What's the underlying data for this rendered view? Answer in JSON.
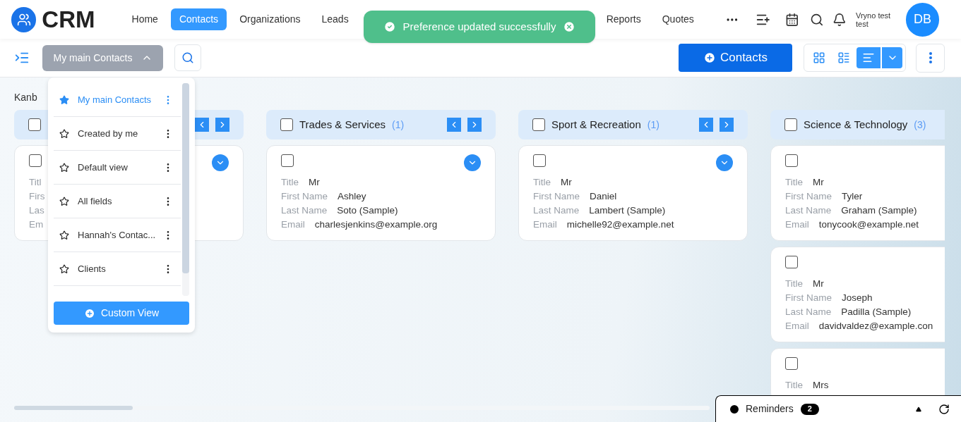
{
  "brand": {
    "name": "CRM"
  },
  "nav": [
    {
      "label": "Home",
      "selected": false
    },
    {
      "label": "Contacts",
      "selected": true
    },
    {
      "label": "Organizations",
      "selected": false
    },
    {
      "label": "Leads",
      "selected": false
    },
    {
      "label": "Reports",
      "selected": false
    },
    {
      "label": "Quotes",
      "selected": false
    }
  ],
  "user": {
    "name": "Vryno test test",
    "initials": "DB"
  },
  "toast": {
    "message": "Preference updated successfully"
  },
  "toolbar": {
    "view_button": {
      "label": "My main Contacts",
      "expanded": true
    },
    "add_button": "Contacts",
    "view_modes": [
      {
        "kind": "grid",
        "selected": false
      },
      {
        "kind": "list",
        "selected": false
      },
      {
        "kind": "kanban",
        "selected": true
      }
    ]
  },
  "view_menu": {
    "items": [
      {
        "label": "My main Contacts",
        "selected": true
      },
      {
        "label": "Created by me",
        "selected": false
      },
      {
        "label": "Default view",
        "selected": false
      },
      {
        "label": "All fields",
        "selected": false
      },
      {
        "label": "Hannah's Contac...",
        "selected": false
      },
      {
        "label": "Clients",
        "selected": false
      }
    ],
    "button": "Custom View"
  },
  "section_label": "Kanb",
  "columns": [
    {
      "checked": false,
      "paging": true,
      "cards": [
        {
          "checked": false,
          "expand_button": true,
          "fields": [
            {
              "label": "Titl"
            },
            {
              "label": "Firs"
            },
            {
              "label": "Las"
            },
            {
              "label": "Em"
            }
          ]
        }
      ]
    },
    {
      "title": "Trades & Services",
      "count": "(1)",
      "checked": false,
      "paging": true,
      "cards": [
        {
          "checked": false,
          "expand_button": true,
          "fields": [
            {
              "label": "Title",
              "value": "Mr"
            },
            {
              "label": "First Name",
              "value": "Ashley"
            },
            {
              "label": "Last Name",
              "value": "Soto (Sample)"
            },
            {
              "label": "Email",
              "value": "charlesjenkins@example.org"
            }
          ]
        }
      ]
    },
    {
      "title": "Sport & Recreation",
      "count": "(1)",
      "checked": false,
      "paging": true,
      "cards": [
        {
          "checked": false,
          "expand_button": true,
          "fields": [
            {
              "label": "Title",
              "value": "Mr"
            },
            {
              "label": "First Name",
              "value": "Daniel"
            },
            {
              "label": "Last Name",
              "value": "Lambert (Sample)"
            },
            {
              "label": "Email",
              "value": "michelle92@example.net"
            }
          ]
        }
      ]
    },
    {
      "title": "Science & Technology",
      "count": "(3)",
      "checked": false,
      "paging": false,
      "cards": [
        {
          "checked": false,
          "expand_button": false,
          "fields": [
            {
              "label": "Title",
              "value": "Mr"
            },
            {
              "label": "First Name",
              "value": "Tyler"
            },
            {
              "label": "Last Name",
              "value": "Graham (Sample)"
            },
            {
              "label": "Email",
              "value": "tonycook@example.net"
            }
          ]
        },
        {
          "checked": false,
          "expand_button": false,
          "fields": [
            {
              "label": "Title",
              "value": "Mr"
            },
            {
              "label": "First Name",
              "value": "Joseph"
            },
            {
              "label": "Last Name",
              "value": "Padilla (Sample)"
            },
            {
              "label": "Email",
              "value": "davidvaldez@example.con"
            }
          ]
        },
        {
          "checked": false,
          "expand_button": false,
          "fields": [
            {
              "label": "Title",
              "value": "Mrs"
            }
          ]
        }
      ]
    }
  ],
  "reminders": {
    "label": "Reminders",
    "count": "2"
  }
}
